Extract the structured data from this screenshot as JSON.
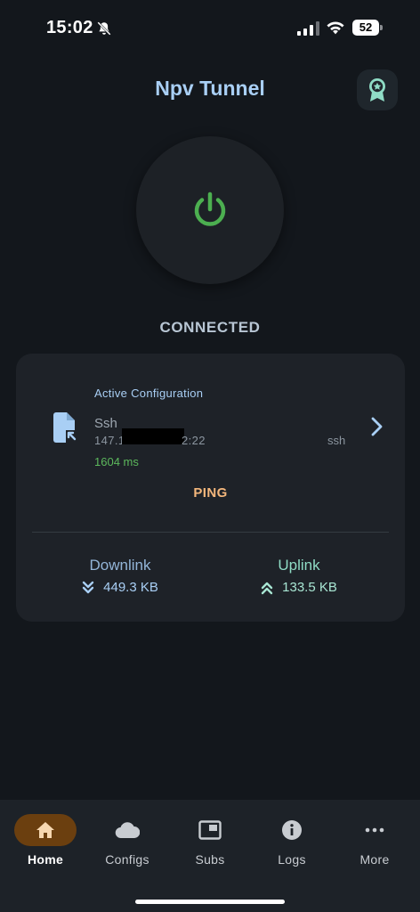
{
  "status_bar": {
    "time": "15:02",
    "battery": "52"
  },
  "app": {
    "title": "Npv Tunnel"
  },
  "connection": {
    "status": "CONNECTED"
  },
  "config": {
    "caption": "Active Configuration",
    "name": "Ssh",
    "host_prefix": "147.1",
    "host_suffix": ":22",
    "host_suffix_partial": "2:22",
    "type": "ssh",
    "latency": "1604 ms",
    "ping_label": "PING"
  },
  "traffic": {
    "downlink_label": "Downlink",
    "downlink_value": "449.3 KB",
    "uplink_label": "Uplink",
    "uplink_value": "133.5 KB"
  },
  "nav": {
    "items": [
      {
        "label": "Home",
        "icon": "home-icon",
        "active": true
      },
      {
        "label": "Configs",
        "icon": "cloud-icon"
      },
      {
        "label": "Subs",
        "icon": "picture-in-picture-icon"
      },
      {
        "label": "Logs",
        "icon": "info-icon"
      },
      {
        "label": "More",
        "icon": "more-horizontal-icon"
      }
    ]
  },
  "colors": {
    "background": "#13171c",
    "accent_blue": "#a9cff5",
    "connected_green": "#4caf50",
    "ping_orange": "#f4b77c",
    "active_nav": "#6b3f0f"
  }
}
